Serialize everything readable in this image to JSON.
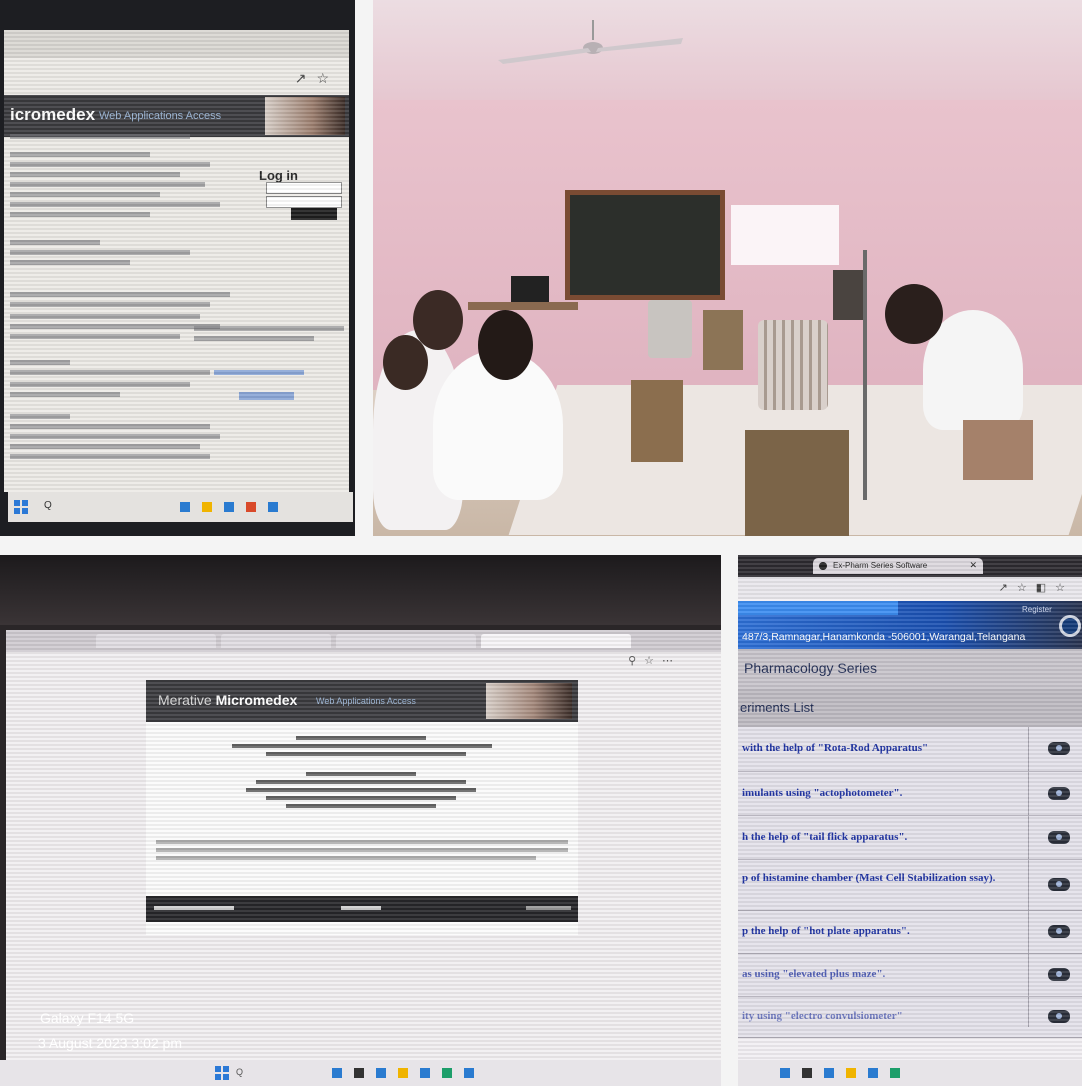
{
  "micromedex_login": {
    "brand": "icromedex",
    "brand_sub": "Web Applications Access",
    "login_title": "Log in"
  },
  "micromedex_logout": {
    "brand_prefix": "Merative",
    "brand_name": "Micromedex",
    "brand_sub": "Web Applications Access"
  },
  "camera_watermark": {
    "device": "Galaxy F14 5G",
    "timestamp": "3 August 2023 3:02 pm"
  },
  "pharmacology": {
    "tab_title": "Ex-Pharm Series Software",
    "address": "487/3,Ramnagar,Hanamkonda -506001,Warangal,Telangana",
    "register": "Register",
    "series_title": "Pharmacology Series",
    "list_title": "eriments List",
    "experiments": [
      "with the help of \"Rota-Rod Apparatus\"",
      "imulants using \"actophotometer\".",
      "h the help of \"tail flick apparatus\".",
      "p of histamine chamber (Mast Cell Stabilization ssay).",
      "p the help of \"hot plate apparatus\".",
      "as using \"elevated plus maze\".",
      "ity using \"electro convulsiometer\""
    ]
  }
}
